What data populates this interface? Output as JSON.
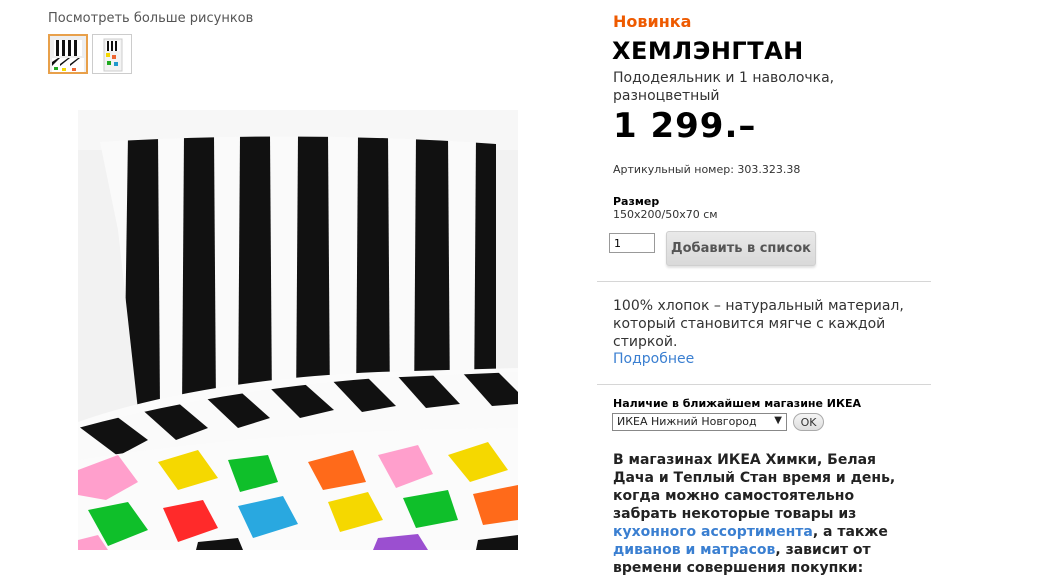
{
  "gallery": {
    "more_label": "Посмотреть больше рисунков",
    "thumbnails": [
      "thumb-striped-bedding",
      "thumb-package"
    ]
  },
  "product": {
    "badge": "Новинка",
    "title": "ХЕМЛЭНГТАН",
    "description": "Пододеяльник и 1 наволочка, разноцветный",
    "price": "1 299.–",
    "article": "Артикульный номер: 303.323.38",
    "size_label": "Размер",
    "size_value": "150x200/50x70 см",
    "quantity": "1",
    "add_button": "Добавить в список",
    "info": "100% хлопок – натуральный материал, который становится мягче с каждой стиркой.",
    "more_link": "Подробнее"
  },
  "availability": {
    "label": "Наличие в ближайшем магазине ИКЕА",
    "store": "ИКЕА Нижний Новгород",
    "ok_button": "OK"
  },
  "notice": {
    "part1": "В магазинах ИКЕА Химки, Белая Дача и Теплый Стан время и день, когда можно самостоятельно забрать некоторые товары из ",
    "link1": "кухонного ассортимента",
    "part2": ", а также ",
    "link2": "диванов и матрасов",
    "part3": ", зависит от времени совершения покупки:"
  },
  "colors": {
    "badge": "#ee5a00",
    "link": "#3a7fd1"
  }
}
